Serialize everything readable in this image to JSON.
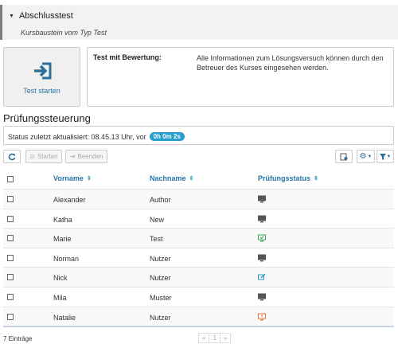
{
  "course": {
    "title": "Abschlusstest",
    "subtitle": "Kursbaustein vom Typ Test"
  },
  "start": {
    "label": "Test starten",
    "icon": "sign-in-icon"
  },
  "info": {
    "label": "Test mit Bewertung:",
    "text": "Alle Informationen zum Lösungsversuch können durch den Betreuer des Kurses eingesehen werden."
  },
  "section": {
    "title": "Prüfungssteuerung"
  },
  "status": {
    "text": "Status zuletzt aktualisiert: 08.45.13 Uhr, vor",
    "timer": "0h 0m 2s"
  },
  "toolbar": {
    "refresh_icon": "refresh-icon",
    "start_label": "Starten",
    "stop_label": "Beenden"
  },
  "table": {
    "columns": {
      "firstname": "Vorname",
      "lastname": "Nachname",
      "status": "Prüfungsstatus"
    },
    "rows": [
      {
        "firstname": "Alexander",
        "lastname": "Author",
        "status_icon": "monitor-icon",
        "status_color": "#555555"
      },
      {
        "firstname": "Katha",
        "lastname": "New",
        "status_icon": "monitor-icon",
        "status_color": "#555555"
      },
      {
        "firstname": "Marie",
        "lastname": "Test",
        "status_icon": "monitor-check-icon",
        "status_color": "#3aa757"
      },
      {
        "firstname": "Norman",
        "lastname": "Nutzer",
        "status_icon": "monitor-icon",
        "status_color": "#555555"
      },
      {
        "firstname": "Nick",
        "lastname": "Nutzer",
        "status_icon": "edit-icon",
        "status_color": "#27a0cf"
      },
      {
        "firstname": "Mila",
        "lastname": "Muster",
        "status_icon": "monitor-icon",
        "status_color": "#555555"
      },
      {
        "firstname": "Natalie",
        "lastname": "Nutzer",
        "status_icon": "monitor-alert-icon",
        "status_color": "#e8753a"
      }
    ]
  },
  "footer": {
    "count": "7 Einträge",
    "pager": {
      "prev": "«",
      "page": "1",
      "next": "»"
    }
  },
  "colors": {
    "accent": "#27a0cf",
    "link": "#2775a7"
  }
}
